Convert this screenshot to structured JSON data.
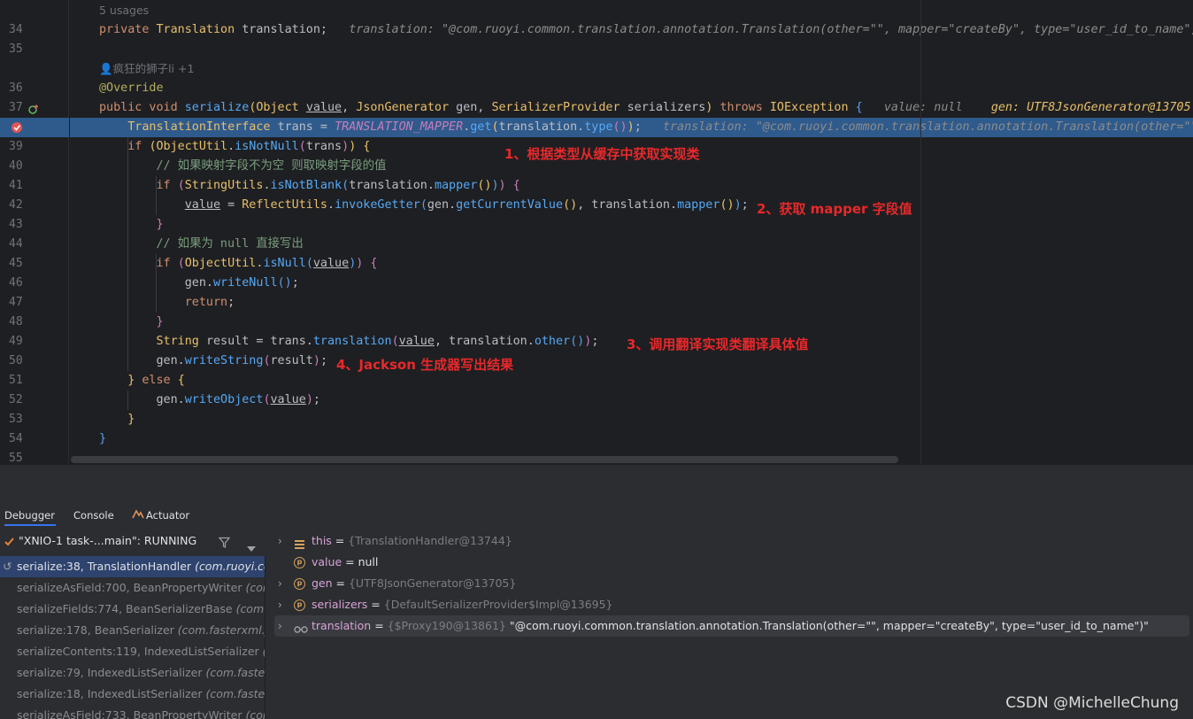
{
  "editor": {
    "usages": "5 usages",
    "author": "疯狂的狮子li +1",
    "line_numbers": [
      "34",
      "35",
      "36",
      "37",
      "39",
      "40",
      "41",
      "42",
      "43",
      "44",
      "45",
      "46",
      "47",
      "48",
      "49",
      "50",
      "51",
      "52",
      "53",
      "54",
      "55"
    ],
    "line38_gutter": "breakpoint",
    "inlay_translation_field": "translation: \"@com.ruoyi.common.translation.annotation.Translation(other=\"\", mapper=\"createBy\", type=\"user_id_to_name\")\"",
    "inlay_value": "value: null",
    "inlay_gen": "gen: UTF8JsonGenerator@13705",
    "inlay_line38": "translation: \"@com.ruoyi.common.translation.annotation.Translation(other=\"\",",
    "comment_40": "// 如果映射字段不为空 则取映射字段的值",
    "comment_44": "// 如果为 null 直接写出"
  },
  "annotations": {
    "note1": "1、根据类型从缓存中获取实现类",
    "note2": "2、获取 mapper 字段值",
    "note3": "3、调用翻译实现类翻译具体值",
    "note4": "4、Jackson 生成器写出结果"
  },
  "debugger": {
    "tabs": [
      "Debugger",
      "Console",
      "Actuator"
    ],
    "thread": "\"XNIO-1 task-...main\": RUNNING",
    "frames": [
      {
        "method": "serialize:38, TranslationHandler",
        "pkg": "(com.ruoyi.co"
      },
      {
        "method": "serializeAsField:700, BeanPropertyWriter",
        "pkg": "(com"
      },
      {
        "method": "serializeFields:774, BeanSerializerBase",
        "pkg": "(com.fa"
      },
      {
        "method": "serialize:178, BeanSerializer",
        "pkg": "(com.fasterxml.jac"
      },
      {
        "method": "serializeContents:119, IndexedListSerializer",
        "pkg": "(c"
      },
      {
        "method": "serialize:79, IndexedListSerializer",
        "pkg": "(com.fasterx"
      },
      {
        "method": "serialize:18, IndexedListSerializer",
        "pkg": "(com.fasterx"
      },
      {
        "method": "serializeAsField:733, BeanPropertyWriter",
        "pkg": "(com"
      }
    ],
    "variables": [
      {
        "name": "this",
        "ref": "{TranslationHandler@13744}",
        "val": "",
        "icon": "field"
      },
      {
        "name": "value",
        "ref": "",
        "val": "= null",
        "icon": "param"
      },
      {
        "name": "gen",
        "ref": "{UTF8JsonGenerator@13705}",
        "val": "",
        "icon": "param"
      },
      {
        "name": "serializers",
        "ref": "{DefaultSerializerProvider$Impl@13695}",
        "val": "",
        "icon": "param"
      },
      {
        "name": "translation",
        "ref": "{$Proxy190@13861}",
        "val": "\"@com.ruoyi.common.translation.annotation.Translation(other=\"\", mapper=\"createBy\", type=\"user_id_to_name\")\"",
        "icon": "watch"
      }
    ]
  },
  "watermark": "CSDN @MichelleChung"
}
